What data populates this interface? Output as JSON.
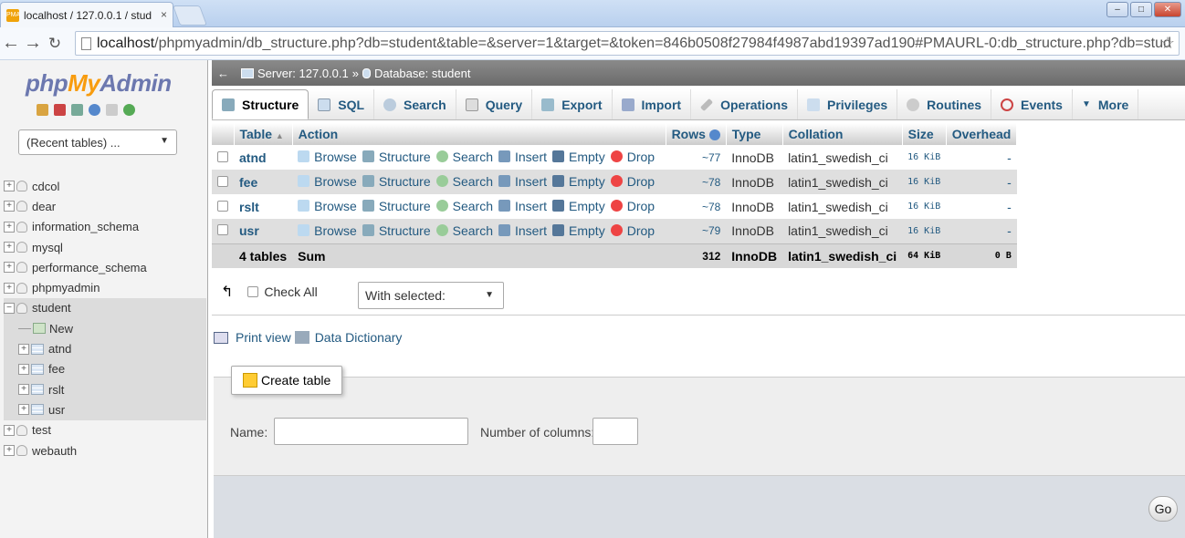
{
  "browser": {
    "tab_title": "localhost / 127.0.0.1 / stud",
    "tab_close": "×",
    "url_host": "localhost",
    "url_rest": "/phpmyadmin/db_structure.php?db=student&table=&server=1&target=&token=846b0508f27984f4987abd19397ad190#PMAURL-0:db_structure.php?db=stud"
  },
  "sidebar": {
    "logo_php": "php",
    "logo_my": "My",
    "logo_admin": "Admin",
    "recent_tables": "(Recent tables) ...",
    "databases": [
      "cdcol",
      "dear",
      "information_schema",
      "mysql",
      "performance_schema",
      "phpmyadmin"
    ],
    "selected_db": "student",
    "new_label": "New",
    "tables": [
      "atnd",
      "fee",
      "rslt",
      "usr"
    ],
    "databases_after": [
      "test",
      "webauth"
    ]
  },
  "breadcrumb": {
    "server": "Server: 127.0.0.1",
    "sep": "»",
    "database": "Database: student"
  },
  "tabs": [
    "Structure",
    "SQL",
    "Search",
    "Query",
    "Export",
    "Import",
    "Operations",
    "Privileges",
    "Routines",
    "Events",
    "More"
  ],
  "table_headers": {
    "table": "Table",
    "action": "Action",
    "rows": "Rows",
    "type": "Type",
    "collation": "Collation",
    "size": "Size",
    "overhead": "Overhead"
  },
  "actions": [
    "Browse",
    "Structure",
    "Search",
    "Insert",
    "Empty",
    "Drop"
  ],
  "rows": [
    {
      "name": "atnd",
      "rows": "~77",
      "type": "InnoDB",
      "collation": "latin1_swedish_ci",
      "size": "16 KiB",
      "overhead": "-"
    },
    {
      "name": "fee",
      "rows": "~78",
      "type": "InnoDB",
      "collation": "latin1_swedish_ci",
      "size": "16 KiB",
      "overhead": "-"
    },
    {
      "name": "rslt",
      "rows": "~78",
      "type": "InnoDB",
      "collation": "latin1_swedish_ci",
      "size": "16 KiB",
      "overhead": "-"
    },
    {
      "name": "usr",
      "rows": "~79",
      "type": "InnoDB",
      "collation": "latin1_swedish_ci",
      "size": "16 KiB",
      "overhead": "-"
    }
  ],
  "summary": {
    "tables": "4 tables",
    "label": "Sum",
    "rows": "312",
    "type": "InnoDB",
    "collation": "latin1_swedish_ci",
    "size": "64 KiB",
    "overhead": "0 B"
  },
  "bulk": {
    "check_all": "Check All",
    "with_selected": "With selected:"
  },
  "links": {
    "print_view": "Print view",
    "data_dictionary": "Data Dictionary"
  },
  "create": {
    "legend": "Create table",
    "name_label": "Name:",
    "columns_label": "Number of columns:",
    "go": "Go"
  }
}
